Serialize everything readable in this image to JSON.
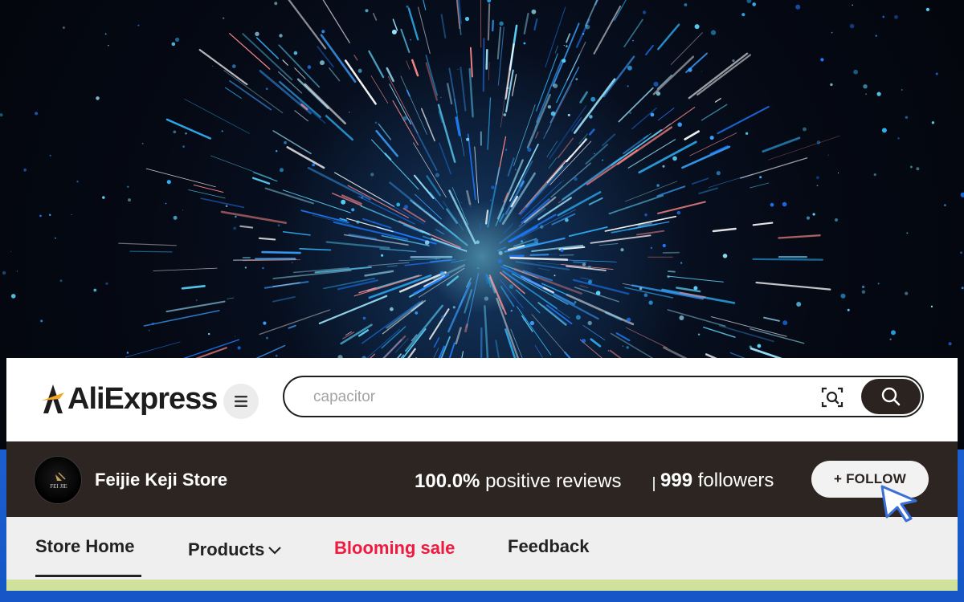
{
  "brand": {
    "logo_text": "AliExpress"
  },
  "search": {
    "placeholder": "capacitor"
  },
  "store": {
    "name": "Feijie Keji Store",
    "avatar_text": "FEI JIE",
    "positive_reviews_value": "100.0%",
    "positive_reviews_label": "positive reviews",
    "followers_value": "999",
    "followers_label": "followers",
    "follow_label": "+ FOLLOW"
  },
  "nav": {
    "items": [
      {
        "label": "Store Home",
        "active": true
      },
      {
        "label": "Products",
        "has_dropdown": true
      },
      {
        "label": "Blooming sale",
        "highlight": true
      },
      {
        "label": "Feedback"
      }
    ]
  },
  "colors": {
    "store_bar": "#2d2522",
    "sale_red": "#f0193f",
    "accent_strip": "#cfe19a",
    "logo_gold": "#f5a623",
    "cursor_blue": "#3b6fd8"
  }
}
